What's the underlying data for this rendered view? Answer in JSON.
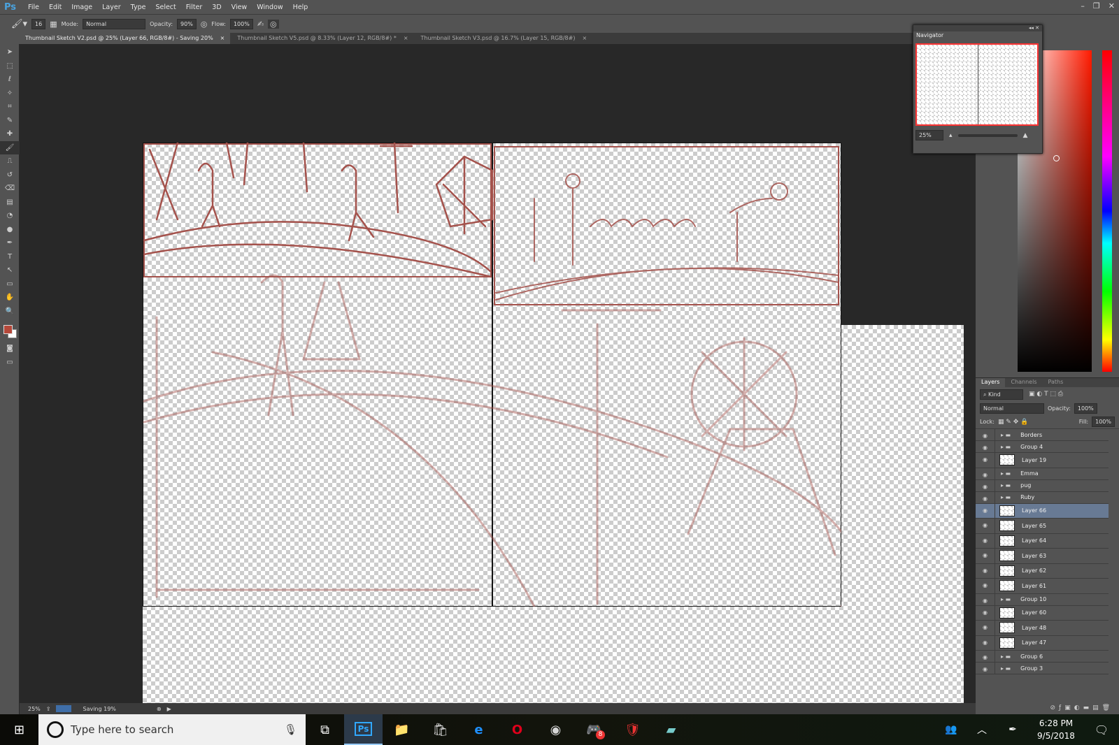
{
  "app": {
    "logo": "Ps",
    "menu": [
      "File",
      "Edit",
      "Image",
      "Layer",
      "Type",
      "Select",
      "Filter",
      "3D",
      "View",
      "Window",
      "Help"
    ],
    "window_controls": [
      "–",
      "❐",
      "✕"
    ]
  },
  "options": {
    "brush_size": "16",
    "mode_label": "Mode:",
    "mode_value": "Normal",
    "opacity_label": "Opacity:",
    "opacity_value": "90%",
    "flow_label": "Flow:",
    "flow_value": "100%"
  },
  "tabs": [
    {
      "label": "Thumbnail Sketch V2.psd @ 25% (Layer 66, RGB/8#) - Saving 20%",
      "active": true
    },
    {
      "label": "Thumbnail Sketch V5.psd @ 8.33% (Layer 12, RGB/8#) *",
      "active": false
    },
    {
      "label": "Thumbnail Sketch V3.psd @ 16.7% (Layer 15, RGB/8#)",
      "active": false
    }
  ],
  "tab_close": "×",
  "tools": [
    "move-tool",
    "marquee-tool",
    "lasso-tool",
    "quick-select-tool",
    "crop-tool",
    "eyedropper-tool",
    "healing-tool",
    "brush-tool",
    "stamp-tool",
    "history-brush-tool",
    "eraser-tool",
    "gradient-tool",
    "blur-tool",
    "dodge-tool",
    "pen-tool",
    "type-tool",
    "path-select-tool",
    "shape-tool",
    "hand-tool",
    "zoom-tool"
  ],
  "colors": {
    "foreground": "#b5483a",
    "background": "#ffffff",
    "sketch": "#a4524c",
    "accent_selection": "#687a94"
  },
  "navigator": {
    "title": "Navigator",
    "zoom": "25%"
  },
  "layers_panel": {
    "tabs": [
      "Layers",
      "Channels",
      "Paths"
    ],
    "filter": "Kind",
    "blend": "Normal",
    "opacity_label": "Opacity:",
    "opacity": "100%",
    "lock_label": "Lock:",
    "fill_label": "Fill:",
    "fill": "100%",
    "layers": [
      {
        "name": "Borders",
        "type": "group"
      },
      {
        "name": "Group 4",
        "type": "group"
      },
      {
        "name": "Layer 19",
        "type": "layer"
      },
      {
        "name": "Emma",
        "type": "group"
      },
      {
        "name": "pug",
        "type": "group"
      },
      {
        "name": "Ruby",
        "type": "group"
      },
      {
        "name": "Layer 66",
        "type": "layer",
        "selected": true
      },
      {
        "name": "Layer 65",
        "type": "layer"
      },
      {
        "name": "Layer 64",
        "type": "layer"
      },
      {
        "name": "Layer 63",
        "type": "layer"
      },
      {
        "name": "Layer 62",
        "type": "layer"
      },
      {
        "name": "Layer 61",
        "type": "layer"
      },
      {
        "name": "Group 10",
        "type": "group"
      },
      {
        "name": "Layer 60",
        "type": "layer"
      },
      {
        "name": "Layer 48",
        "type": "layer"
      },
      {
        "name": "Layer 47",
        "type": "layer"
      },
      {
        "name": "Group 6",
        "type": "group"
      },
      {
        "name": "Group 3",
        "type": "group"
      }
    ]
  },
  "status": {
    "zoom": "25%",
    "message": "Saving 19%",
    "progress": 0.19
  },
  "taskbar": {
    "search_placeholder": "Type here to search",
    "time": "6:28 PM",
    "date": "9/5/2018",
    "discord_badge": "8"
  }
}
